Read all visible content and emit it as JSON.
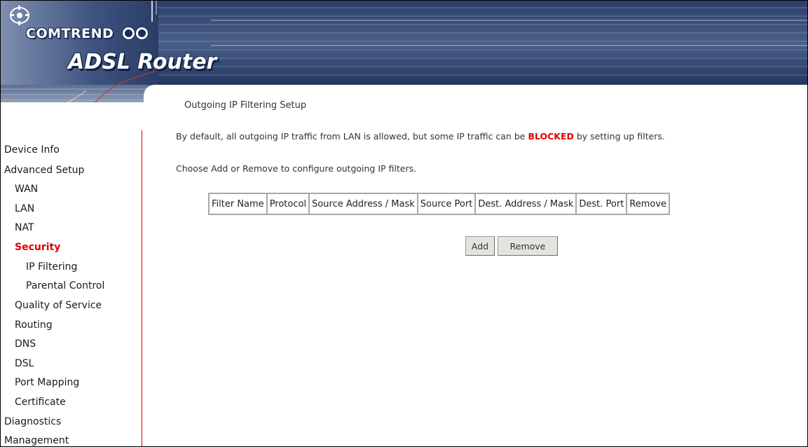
{
  "header": {
    "brand": "COMTREND",
    "product": "ADSL Router",
    "colors": {
      "banner_dark": "#1a2d55",
      "banner_mid": "#5a6f95",
      "banner_light": "#c9d2e3",
      "accent_red": "#cc0000"
    }
  },
  "sidebar": {
    "items": [
      {
        "label": "Device Info",
        "level": 0,
        "active": false
      },
      {
        "label": "Advanced Setup",
        "level": 0,
        "active": false
      },
      {
        "label": "WAN",
        "level": 1,
        "active": false
      },
      {
        "label": "LAN",
        "level": 1,
        "active": false
      },
      {
        "label": "NAT",
        "level": 1,
        "active": false
      },
      {
        "label": "Security",
        "level": 1,
        "active": true
      },
      {
        "label": "IP Filtering",
        "level": 2,
        "active": false
      },
      {
        "label": "Parental Control",
        "level": 2,
        "active": false
      },
      {
        "label": "Quality of Service",
        "level": 1,
        "active": false
      },
      {
        "label": "Routing",
        "level": 1,
        "active": false
      },
      {
        "label": "DNS",
        "level": 1,
        "active": false
      },
      {
        "label": "DSL",
        "level": 1,
        "active": false
      },
      {
        "label": "Port Mapping",
        "level": 1,
        "active": false
      },
      {
        "label": "Certificate",
        "level": 1,
        "active": false
      },
      {
        "label": "Diagnostics",
        "level": 0,
        "active": false
      },
      {
        "label": "Management",
        "level": 0,
        "active": false
      }
    ]
  },
  "main": {
    "title": "Outgoing IP Filtering Setup",
    "description_before": "By default, all outgoing IP traffic from LAN is allowed, but some IP traffic can be ",
    "description_blocked": "BLOCKED",
    "description_after": " by setting up filters.",
    "instruction": "Choose Add or Remove to configure outgoing IP filters.",
    "table": {
      "columns": [
        "Filter Name",
        "Protocol",
        "Source Address / Mask",
        "Source Port",
        "Dest. Address / Mask",
        "Dest. Port",
        "Remove"
      ],
      "rows": []
    },
    "buttons": {
      "add": "Add",
      "remove": "Remove"
    }
  }
}
